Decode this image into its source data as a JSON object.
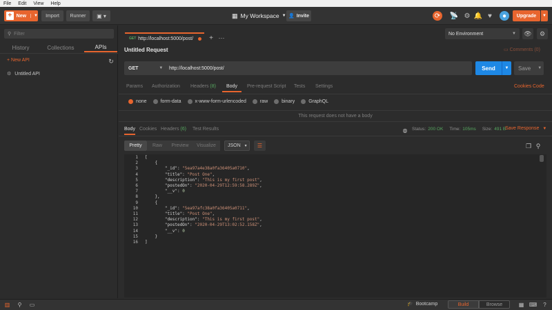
{
  "menubar": {
    "items": [
      "File",
      "Edit",
      "View",
      "Help"
    ]
  },
  "header": {
    "new_label": "New",
    "import_label": "Import",
    "runner_label": "Runner",
    "workspace": "My Workspace",
    "invite_label": "Invite",
    "upgrade_label": "Upgrade"
  },
  "sidebar": {
    "filter_placeholder": "Filter",
    "tabs": [
      "History",
      "Collections",
      "APIs"
    ],
    "new_api_label": "+ New API",
    "apis": [
      "Untitled API"
    ]
  },
  "request_tab": {
    "method": "GET",
    "url": "http://localhost:5000/post/"
  },
  "environment": "No Environment",
  "request": {
    "name": "Untitled Request",
    "comments_label": "Comments (0)",
    "method": "GET",
    "url": "http://localhost:5000/post/",
    "send_label": "Send",
    "save_label": "Save",
    "tabs": [
      {
        "label": "Params"
      },
      {
        "label": "Authorization"
      },
      {
        "label": "Headers",
        "count": "(8)"
      },
      {
        "label": "Body"
      },
      {
        "label": "Pre-request Script"
      },
      {
        "label": "Tests"
      },
      {
        "label": "Settings"
      }
    ],
    "cookies_label": "Cookies",
    "code_label": "Code",
    "body_modes": [
      "none",
      "form-data",
      "x-www-form-urlencoded",
      "raw",
      "binary",
      "GraphQL"
    ],
    "no_body_text": "This request does not have a body"
  },
  "response": {
    "tabs": [
      {
        "label": "Body"
      },
      {
        "label": "Cookies"
      },
      {
        "label": "Headers",
        "count": "(6)"
      },
      {
        "label": "Test Results"
      }
    ],
    "status_label": "Status:",
    "status_value": "200 OK",
    "time_label": "Time:",
    "time_value": "105ms",
    "size_label": "Size:",
    "size_value": "491 B",
    "save_response_label": "Save Response",
    "view_modes": [
      "Pretty",
      "Raw",
      "Preview",
      "Visualize"
    ],
    "format": "JSON",
    "line_numbers": [
      "1",
      "2",
      "3",
      "4",
      "5",
      "6",
      "7",
      "8",
      "9",
      "10",
      "11",
      "12",
      "13",
      "14",
      "15",
      "16"
    ],
    "code_lines": [
      "[",
      "    {",
      "        \"_id\": \"5ea97a4e38a0fa36405a0710\",",
      "        \"title\": \"Post One\",",
      "        \"description\": \"This is my first post\",",
      "        \"postedOn\": \"2020-04-29T12:59:58.289Z\",",
      "        \"__v\": 0",
      "    },",
      "    {",
      "        \"_id\": \"5ea97afc38a0fa36405a0711\",",
      "        \"title\": \"Post One\",",
      "        \"description\": \"This is my first post\",",
      "        \"postedOn\": \"2020-04-29T13:02:52.158Z\",",
      "        \"__v\": 0",
      "    }",
      "]"
    ]
  },
  "statusbar": {
    "bootcamp_label": "Bootcamp",
    "build_label": "Build",
    "browse_label": "Browse"
  },
  "colors": {
    "accent": "#e8652e",
    "send": "#1e88e5",
    "status_ok": "#57a960"
  }
}
